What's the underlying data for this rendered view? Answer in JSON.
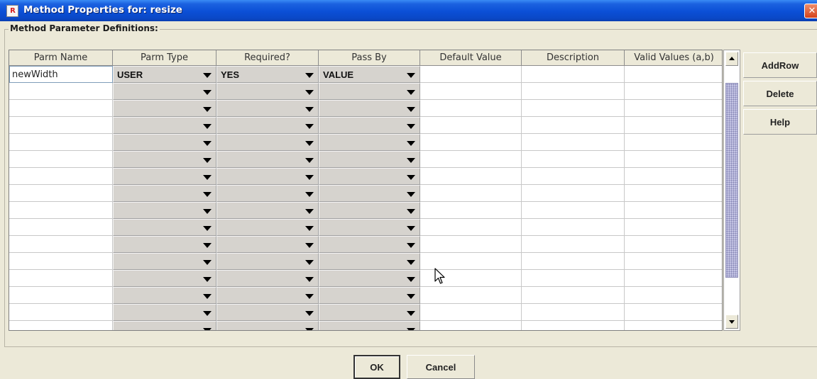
{
  "window": {
    "title": "Method Properties for: resize",
    "app_icon_text": "R",
    "close_glyph": "✕"
  },
  "group": {
    "title": "Method Parameter Definitions:"
  },
  "table": {
    "headers": [
      "Parm Name",
      "Parm Type",
      "Required?",
      "Pass By",
      "Default Value",
      "Description",
      "Valid Values (a,b)"
    ],
    "rows": [
      {
        "parm_name": "newWidth",
        "parm_type": "USER",
        "required": "YES",
        "pass_by": "VALUE",
        "default_value": "",
        "description": "",
        "valid_values": ""
      },
      {
        "parm_name": "",
        "parm_type": "",
        "required": "",
        "pass_by": "",
        "default_value": "",
        "description": "",
        "valid_values": ""
      },
      {
        "parm_name": "",
        "parm_type": "",
        "required": "",
        "pass_by": "",
        "default_value": "",
        "description": "",
        "valid_values": ""
      },
      {
        "parm_name": "",
        "parm_type": "",
        "required": "",
        "pass_by": "",
        "default_value": "",
        "description": "",
        "valid_values": ""
      },
      {
        "parm_name": "",
        "parm_type": "",
        "required": "",
        "pass_by": "",
        "default_value": "",
        "description": "",
        "valid_values": ""
      },
      {
        "parm_name": "",
        "parm_type": "",
        "required": "",
        "pass_by": "",
        "default_value": "",
        "description": "",
        "valid_values": ""
      },
      {
        "parm_name": "",
        "parm_type": "",
        "required": "",
        "pass_by": "",
        "default_value": "",
        "description": "",
        "valid_values": ""
      },
      {
        "parm_name": "",
        "parm_type": "",
        "required": "",
        "pass_by": "",
        "default_value": "",
        "description": "",
        "valid_values": ""
      },
      {
        "parm_name": "",
        "parm_type": "",
        "required": "",
        "pass_by": "",
        "default_value": "",
        "description": "",
        "valid_values": ""
      },
      {
        "parm_name": "",
        "parm_type": "",
        "required": "",
        "pass_by": "",
        "default_value": "",
        "description": "",
        "valid_values": ""
      },
      {
        "parm_name": "",
        "parm_type": "",
        "required": "",
        "pass_by": "",
        "default_value": "",
        "description": "",
        "valid_values": ""
      },
      {
        "parm_name": "",
        "parm_type": "",
        "required": "",
        "pass_by": "",
        "default_value": "",
        "description": "",
        "valid_values": ""
      },
      {
        "parm_name": "",
        "parm_type": "",
        "required": "",
        "pass_by": "",
        "default_value": "",
        "description": "",
        "valid_values": ""
      },
      {
        "parm_name": "",
        "parm_type": "",
        "required": "",
        "pass_by": "",
        "default_value": "",
        "description": "",
        "valid_values": ""
      },
      {
        "parm_name": "",
        "parm_type": "",
        "required": "",
        "pass_by": "",
        "default_value": "",
        "description": "",
        "valid_values": ""
      },
      {
        "parm_name": "",
        "parm_type": "",
        "required": "",
        "pass_by": "",
        "default_value": "",
        "description": "",
        "valid_values": ""
      }
    ]
  },
  "side_buttons": {
    "add_row": "AddRow",
    "delete": "Delete",
    "help": "Help"
  },
  "footer": {
    "ok": "OK",
    "cancel": "Cancel"
  },
  "colors": {
    "title_bar": "#0a4fd6",
    "dialog_background": "#ece9d8",
    "combo_background": "#d6d3ce",
    "scroll_thumb": "#c4c4e4",
    "close_button": "#d4421c"
  },
  "icons": {
    "dropdown_arrow": "chevron-down-icon",
    "scroll_up": "arrow-up-icon",
    "scroll_down": "arrow-down-icon",
    "mouse_cursor": "cursor-icon",
    "close": "close-icon"
  }
}
